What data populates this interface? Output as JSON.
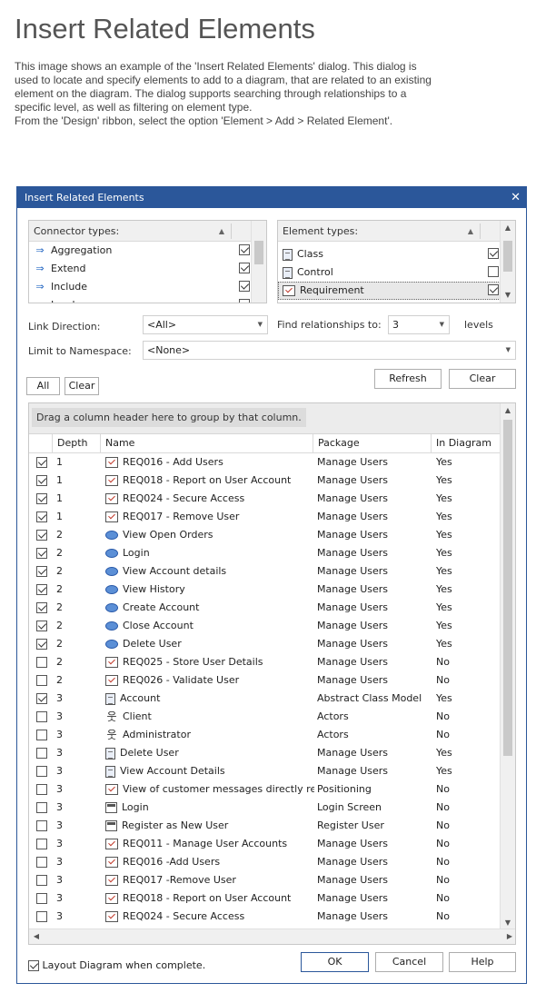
{
  "page": {
    "title": "Insert Related Elements",
    "intro": [
      "This image shows an example of the 'Insert Related Elements' dialog. This dialog is",
      "used to locate and specify elements to add to a diagram, that are related to an existing",
      "element on the diagram. The dialog supports searching through relationships to a",
      "specific level, as well as filtering on element type.",
      "From the 'Design' ribbon, select the option 'Element > Add > Related Element'."
    ]
  },
  "dialog": {
    "title": "Insert Related Elements",
    "close_glyph": "✕",
    "connector_types": {
      "header": "Connector types:",
      "items": [
        {
          "label": "Aggregation",
          "checked": true
        },
        {
          "label": "Extend",
          "checked": true
        },
        {
          "label": "Include",
          "checked": true
        },
        {
          "label": "Invokes",
          "checked": false
        }
      ]
    },
    "element_types": {
      "header": "Element types:",
      "items": [
        {
          "label": "Class",
          "checked": true,
          "icon": "class-icon"
        },
        {
          "label": "Control",
          "checked": false,
          "icon": "class-icon"
        },
        {
          "label": "Requirement",
          "checked": true,
          "icon": "requirement-icon",
          "selected": true
        }
      ]
    },
    "link_direction": {
      "label": "Link Direction:",
      "value": "<All>"
    },
    "find_relationships": {
      "label": "Find relationships to:",
      "value": "3",
      "suffix": "levels"
    },
    "limit_namespace": {
      "label": "Limit to Namespace:",
      "value": "<None>"
    },
    "buttons": {
      "all": "All",
      "clear_small": "Clear",
      "refresh": "Refresh",
      "clear": "Clear",
      "ok": "OK",
      "cancel": "Cancel",
      "help": "Help"
    },
    "grid": {
      "group_hint": "Drag a column header here to group by that column.",
      "columns": [
        "Depth",
        "Name",
        "Package",
        "In Diagram"
      ],
      "rows": [
        {
          "checked": true,
          "depth": "1",
          "icon": "requirement-icon",
          "name": "REQ016 - Add Users",
          "package": "Manage Users",
          "in_diagram": "Yes"
        },
        {
          "checked": true,
          "depth": "1",
          "icon": "requirement-icon",
          "name": "REQ018 - Report on User Account",
          "package": "Manage Users",
          "in_diagram": "Yes"
        },
        {
          "checked": true,
          "depth": "1",
          "icon": "requirement-icon",
          "name": "REQ024 - Secure Access",
          "package": "Manage Users",
          "in_diagram": "Yes"
        },
        {
          "checked": true,
          "depth": "1",
          "icon": "requirement-icon",
          "name": "REQ017 - Remove User",
          "package": "Manage Users",
          "in_diagram": "Yes"
        },
        {
          "checked": true,
          "depth": "2",
          "icon": "use-case-icon",
          "name": "View Open Orders",
          "package": "Manage Users",
          "in_diagram": "Yes"
        },
        {
          "checked": true,
          "depth": "2",
          "icon": "use-case-icon",
          "name": "Login",
          "package": "Manage Users",
          "in_diagram": "Yes"
        },
        {
          "checked": true,
          "depth": "2",
          "icon": "use-case-icon",
          "name": "View Account details",
          "package": "Manage Users",
          "in_diagram": "Yes"
        },
        {
          "checked": true,
          "depth": "2",
          "icon": "use-case-icon",
          "name": "View History",
          "package": "Manage Users",
          "in_diagram": "Yes"
        },
        {
          "checked": true,
          "depth": "2",
          "icon": "use-case-icon",
          "name": "Create Account",
          "package": "Manage Users",
          "in_diagram": "Yes"
        },
        {
          "checked": true,
          "depth": "2",
          "icon": "use-case-icon",
          "name": "Close Account",
          "package": "Manage Users",
          "in_diagram": "Yes"
        },
        {
          "checked": true,
          "depth": "2",
          "icon": "use-case-icon",
          "name": "Delete User",
          "package": "Manage Users",
          "in_diagram": "Yes"
        },
        {
          "checked": false,
          "depth": "2",
          "icon": "requirement-icon",
          "name": "REQ025 - Store User Details",
          "package": "Manage Users",
          "in_diagram": "No"
        },
        {
          "checked": false,
          "depth": "2",
          "icon": "requirement-icon",
          "name": "REQ026 - Validate User",
          "package": "Manage Users",
          "in_diagram": "No"
        },
        {
          "checked": true,
          "depth": "3",
          "icon": "class-icon",
          "name": "Account",
          "package": "Abstract Class Model",
          "in_diagram": "Yes"
        },
        {
          "checked": false,
          "depth": "3",
          "icon": "actor-icon",
          "name": "Client",
          "package": "Actors",
          "in_diagram": "No"
        },
        {
          "checked": false,
          "depth": "3",
          "icon": "actor-icon",
          "name": "Administrator",
          "package": "Actors",
          "in_diagram": "No"
        },
        {
          "checked": false,
          "depth": "3",
          "icon": "class-icon",
          "name": "Delete User",
          "package": "Manage Users",
          "in_diagram": "Yes"
        },
        {
          "checked": false,
          "depth": "3",
          "icon": "class-icon",
          "name": "View Account Details",
          "package": "Manage Users",
          "in_diagram": "Yes"
        },
        {
          "checked": false,
          "depth": "3",
          "icon": "requirement-icon",
          "name": "View of customer messages directly rela...",
          "package": "Positioning",
          "in_diagram": "No"
        },
        {
          "checked": false,
          "depth": "3",
          "icon": "screen-icon",
          "name": "Login",
          "package": "Login Screen",
          "in_diagram": "No"
        },
        {
          "checked": false,
          "depth": "3",
          "icon": "screen-icon",
          "name": "Register as New User",
          "package": "Register User",
          "in_diagram": "No"
        },
        {
          "checked": false,
          "depth": "3",
          "icon": "requirement-icon",
          "name": "REQ011 - Manage User Accounts",
          "package": "Manage Users",
          "in_diagram": "No"
        },
        {
          "checked": false,
          "depth": "3",
          "icon": "requirement-icon",
          "name": "REQ016 -Add Users",
          "package": "Manage Users",
          "in_diagram": "No"
        },
        {
          "checked": false,
          "depth": "3",
          "icon": "requirement-icon",
          "name": "REQ017 -Remove User",
          "package": "Manage Users",
          "in_diagram": "No"
        },
        {
          "checked": false,
          "depth": "3",
          "icon": "requirement-icon",
          "name": "REQ018 - Report on User Account",
          "package": "Manage Users",
          "in_diagram": "No"
        },
        {
          "checked": false,
          "depth": "3",
          "icon": "requirement-icon",
          "name": "REQ024 - Secure Access",
          "package": "Manage Users",
          "in_diagram": "No"
        }
      ]
    },
    "layout_option": {
      "label": "Layout Diagram when complete.",
      "checked": true
    }
  }
}
